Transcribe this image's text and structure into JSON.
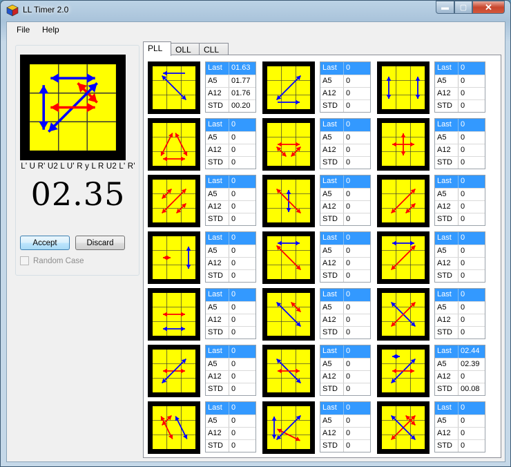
{
  "window": {
    "title": "LL Timer 2.0",
    "minimize": "▬",
    "maximize": "▢",
    "close": "✕"
  },
  "menu": {
    "file": "File",
    "help": "Help"
  },
  "left": {
    "algorithm": "L' U R' U2 L U' R y L R U2 L' R'",
    "time": "02.35",
    "accept": "Accept",
    "discard": "Discard",
    "random_case": "Random Case",
    "random_case_checked": false
  },
  "tabs": [
    "PLL",
    "OLL",
    "CLL"
  ],
  "active_tab": "PLL",
  "stat_labels": [
    "Last",
    "A5",
    "A12",
    "STD"
  ],
  "cases": [
    {
      "values": [
        "01.63",
        "01.77",
        "01.76",
        "00.20"
      ]
    },
    {
      "values": [
        "0",
        "0",
        "0",
        "0"
      ]
    },
    {
      "values": [
        "0",
        "0",
        "0",
        "0"
      ]
    },
    {
      "values": [
        "0",
        "0",
        "0",
        "0"
      ]
    },
    {
      "values": [
        "0",
        "0",
        "0",
        "0"
      ]
    },
    {
      "values": [
        "0",
        "0",
        "0",
        "0"
      ]
    },
    {
      "values": [
        "0",
        "0",
        "0",
        "0"
      ]
    },
    {
      "values": [
        "0",
        "0",
        "0",
        "0"
      ]
    },
    {
      "values": [
        "0",
        "0",
        "0",
        "0"
      ]
    },
    {
      "values": [
        "0",
        "0",
        "0",
        "0"
      ]
    },
    {
      "values": [
        "0",
        "0",
        "0",
        "0"
      ]
    },
    {
      "values": [
        "0",
        "0",
        "0",
        "0"
      ]
    },
    {
      "values": [
        "0",
        "0",
        "0",
        "0"
      ]
    },
    {
      "values": [
        "0",
        "0",
        "0",
        "0"
      ]
    },
    {
      "values": [
        "0",
        "0",
        "0",
        "0"
      ]
    },
    {
      "values": [
        "0",
        "0",
        "0",
        "0"
      ]
    },
    {
      "values": [
        "0",
        "0",
        "0",
        "0"
      ]
    },
    {
      "values": [
        "02.44",
        "02.39",
        "0",
        "00.08"
      ]
    },
    {
      "values": [
        "0",
        "0",
        "0",
        "0"
      ]
    },
    {
      "values": [
        "0",
        "0",
        "0",
        "0"
      ]
    },
    {
      "values": [
        "0",
        "0",
        "0",
        "0"
      ]
    }
  ],
  "colors": {
    "sticker": "#ffff00",
    "frame": "#000000",
    "arrow_red": "#ff0000",
    "arrow_blue": "#0000ff",
    "selected_row": "#3399ff"
  }
}
